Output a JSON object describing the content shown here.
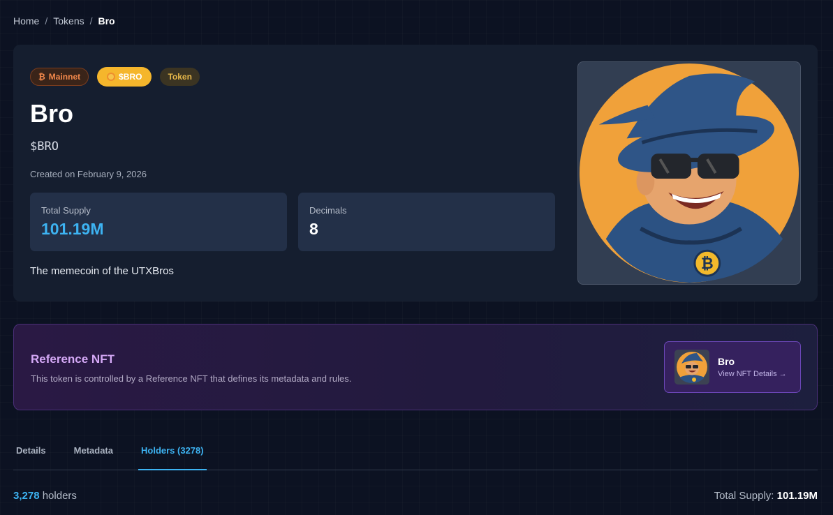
{
  "breadcrumb": {
    "items": [
      "Home",
      "Tokens"
    ],
    "separator": "/",
    "current": "Bro"
  },
  "token": {
    "badges": {
      "network": "Mainnet",
      "network_icon": "₿",
      "ticker": "$BRO",
      "type": "Token"
    },
    "name": "Bro",
    "symbol": "$BRO",
    "created": "Created on February 9, 2026",
    "stats": {
      "supply_label": "Total Supply",
      "supply_value": "101.19M",
      "decimals_label": "Decimals",
      "decimals_value": "8"
    },
    "description": "The memecoin of the UTXBros",
    "image_icon": "wizard-bro-avatar"
  },
  "reference_nft": {
    "title": "Reference NFT",
    "description": "This token is controlled by a Reference NFT that defines its metadata and rules.",
    "name": "Bro",
    "view_label": "View NFT Details →"
  },
  "tabs": [
    "Details",
    "Metadata",
    "Holders (3278)"
  ],
  "active_tab": "Holders (3278)",
  "holders": {
    "count": "3,278",
    "count_suffix": "holders",
    "supply_label": "Total Supply:",
    "supply_value": "101.19M"
  },
  "colors": {
    "accent": "#3db3f2",
    "ticker_badge": "#f5b62c",
    "network_badge": "#f2884b",
    "nft_title": "#d5a9f7"
  }
}
